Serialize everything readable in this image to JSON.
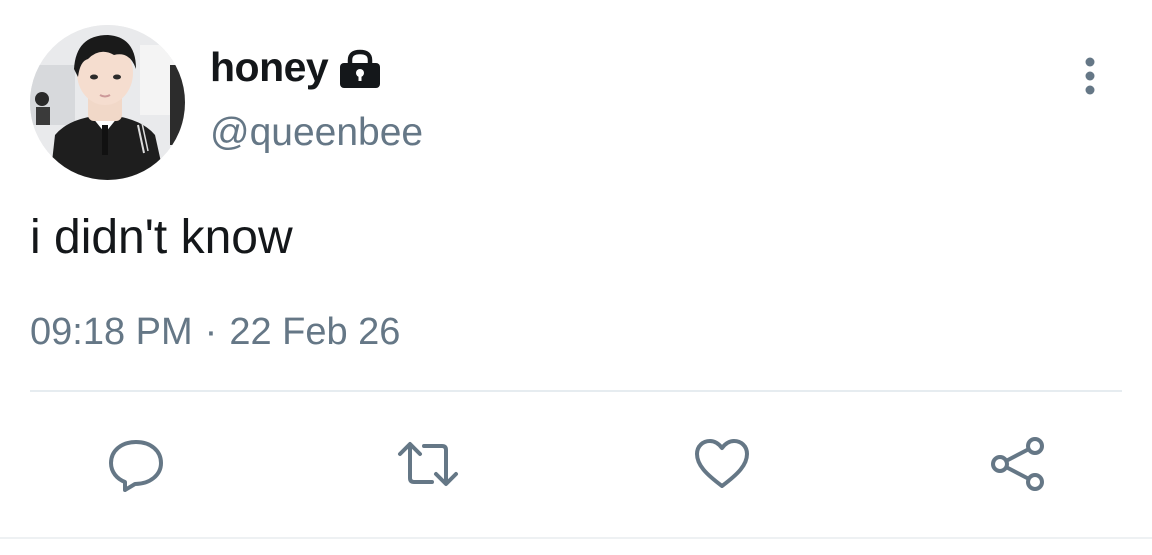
{
  "user": {
    "display_name": "honey",
    "handle": "@queenbee",
    "protected_icon": "lock-icon",
    "avatar": "profile-photo"
  },
  "tweet": {
    "text": "i didn't know",
    "time": "09:18 PM",
    "separator": "·",
    "date": "22 Feb 26"
  },
  "actions": [
    {
      "icon": "reply-icon"
    },
    {
      "icon": "retweet-icon"
    },
    {
      "icon": "like-icon"
    },
    {
      "icon": "share-icon"
    }
  ],
  "menu_icon": "more-vertical-icon",
  "colors": {
    "text_primary": "#14171a",
    "text_secondary": "#657786",
    "divider": "#e6ecf0"
  }
}
